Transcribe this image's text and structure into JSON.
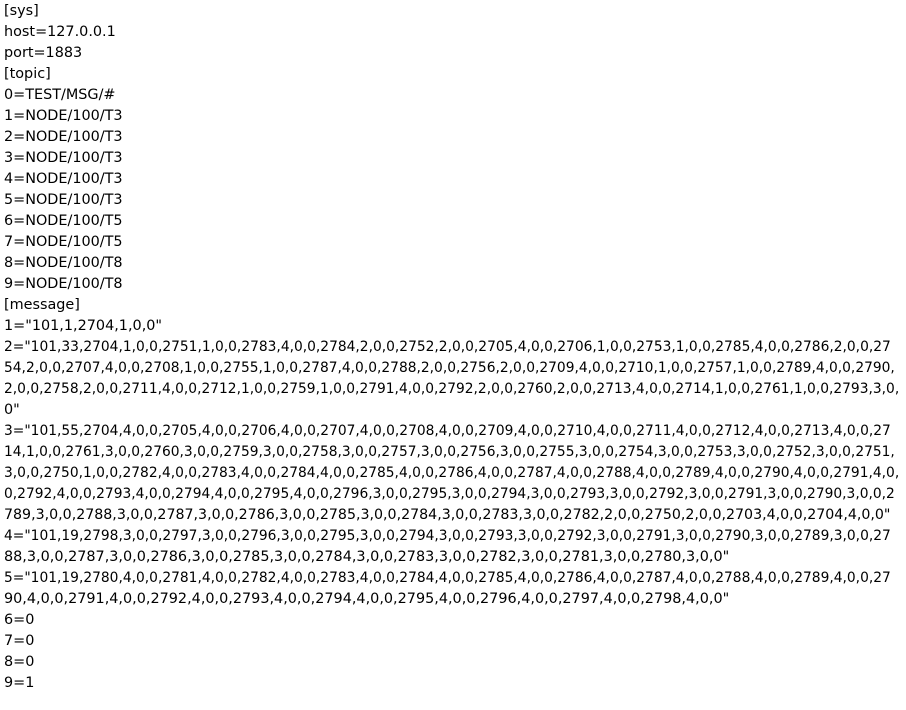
{
  "lines": [
    "[sys]",
    "host=127.0.0.1",
    "port=1883",
    "[topic]",
    "0=TEST/MSG/#",
    "1=NODE/100/T3",
    "2=NODE/100/T3",
    "3=NODE/100/T3",
    "4=NODE/100/T3",
    "5=NODE/100/T3",
    "6=NODE/100/T5",
    "7=NODE/100/T5",
    "8=NODE/100/T8",
    "9=NODE/100/T8",
    "[message]",
    "1=\"101,1,2704,1,0,0\"",
    "2=\"101,33,2704,1,0,0,2751,1,0,0,2783,4,0,0,2784,2,0,0,2752,2,0,0,2705,4,0,0,2706,1,0,0,2753,1,0,0,2785,4,0,0,2786,2,0,0,27",
    "54,2,0,0,2707,4,0,0,2708,1,0,0,2755,1,0,0,2787,4,0,0,2788,2,0,0,2756,2,0,0,2709,4,0,0,2710,1,0,0,2757,1,0,0,2789,4,0,0,2790,",
    "2,0,0,2758,2,0,0,2711,4,0,0,2712,1,0,0,2759,1,0,0,2791,4,0,0,2792,2,0,0,2760,2,0,0,2713,4,0,0,2714,1,0,0,2761,1,0,0,2793,3,0,",
    "0\"",
    "3=\"101,55,2704,4,0,0,2705,4,0,0,2706,4,0,0,2707,4,0,0,2708,4,0,0,2709,4,0,0,2710,4,0,0,2711,4,0,0,2712,4,0,0,2713,4,0,0,27",
    "14,1,0,0,2761,3,0,0,2760,3,0,0,2759,3,0,0,2758,3,0,0,2757,3,0,0,2756,3,0,0,2755,3,0,0,2754,3,0,0,2753,3,0,0,2752,3,0,0,2751,",
    "3,0,0,2750,1,0,0,2782,4,0,0,2783,4,0,0,2784,4,0,0,2785,4,0,0,2786,4,0,0,2787,4,0,0,2788,4,0,0,2789,4,0,0,2790,4,0,0,2791,4,0,",
    "0,2792,4,0,0,2793,4,0,0,2794,4,0,0,2795,4,0,0,2796,3,0,0,2795,3,0,0,2794,3,0,0,2793,3,0,0,2792,3,0,0,2791,3,0,0,2790,3,0,0,2",
    "789,3,0,0,2788,3,0,0,2787,3,0,0,2786,3,0,0,2785,3,0,0,2784,3,0,0,2783,3,0,0,2782,2,0,0,2750,2,0,0,2703,4,0,0,2704,4,0,0\"",
    "4=\"101,19,2798,3,0,0,2797,3,0,0,2796,3,0,0,2795,3,0,0,2794,3,0,0,2793,3,0,0,2792,3,0,0,2791,3,0,0,2790,3,0,0,2789,3,0,0,27",
    "88,3,0,0,2787,3,0,0,2786,3,0,0,2785,3,0,0,2784,3,0,0,2783,3,0,0,2782,3,0,0,2781,3,0,0,2780,3,0,0\"",
    "5=\"101,19,2780,4,0,0,2781,4,0,0,2782,4,0,0,2783,4,0,0,2784,4,0,0,2785,4,0,0,2786,4,0,0,2787,4,0,0,2788,4,0,0,2789,4,0,0,27",
    "90,4,0,0,2791,4,0,0,2792,4,0,0,2793,4,0,0,2794,4,0,0,2795,4,0,0,2796,4,0,0,2797,4,0,0,2798,4,0,0\"",
    "6=0",
    "7=0",
    "8=0",
    "9=1"
  ]
}
